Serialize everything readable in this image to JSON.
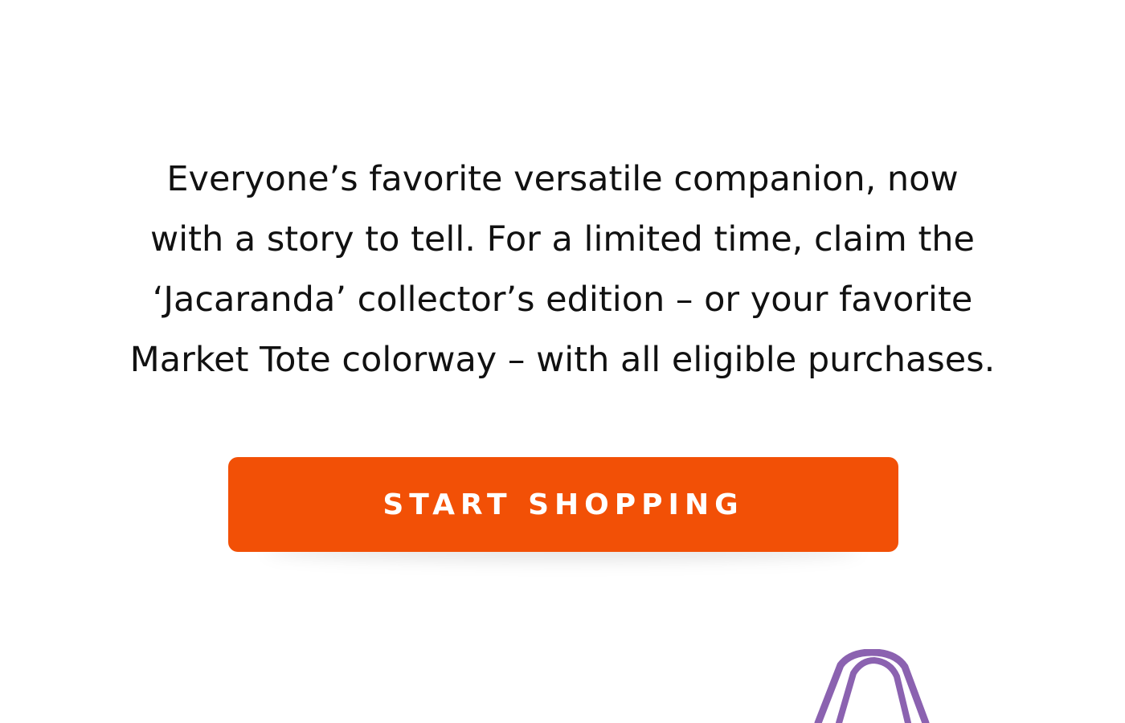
{
  "promo": {
    "lines": [
      "Everyone’s favorite versatile companion, now",
      "with a story to tell. For a limited time, claim the",
      "‘Jacaranda’ collector’s edition – or your favorite",
      "Market Tote colorway – with all eligible purchases."
    ]
  },
  "cta": {
    "label": "START SHOPPING",
    "color": "#F25006"
  },
  "product_image": {
    "icon": "market-tote-bag-icon",
    "color": "#8B62B0"
  }
}
